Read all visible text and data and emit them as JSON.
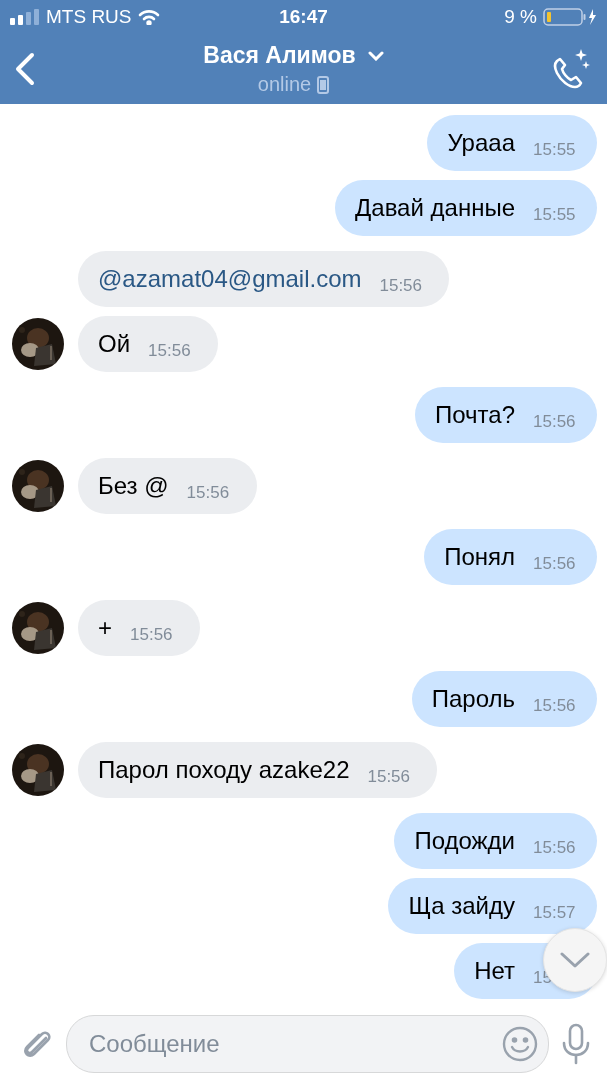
{
  "status_bar": {
    "carrier": "MTS RUS",
    "time": "16:47",
    "battery": "9 %"
  },
  "header": {
    "title": "Вася Алимов",
    "status": "online"
  },
  "messages": [
    {
      "outgoing": true,
      "text": "Урааа",
      "time": "15:55"
    },
    {
      "outgoing": true,
      "text": "Давай данные",
      "time": "15:55"
    },
    {
      "outgoing": false,
      "text": "@azamat04@gmail.com",
      "time": "15:56",
      "link": true
    },
    {
      "outgoing": false,
      "text": "Ой",
      "time": "15:56",
      "link": false
    },
    {
      "outgoing": true,
      "text": "Почта?",
      "time": "15:56"
    },
    {
      "outgoing": false,
      "text": "Без @",
      "time": "15:56",
      "link": false
    },
    {
      "outgoing": true,
      "text": "Понял",
      "time": "15:56"
    },
    {
      "outgoing": false,
      "text": "+",
      "time": "15:56",
      "link": false
    },
    {
      "outgoing": true,
      "text": "Пароль",
      "time": "15:56"
    },
    {
      "outgoing": false,
      "text": "Парол походу azake22",
      "time": "15:56",
      "link": false
    },
    {
      "outgoing": true,
      "text": "Подожди",
      "time": "15:56"
    },
    {
      "outgoing": true,
      "text": "Ща зайду",
      "time": "15:57"
    },
    {
      "outgoing": true,
      "text": "Нет",
      "time": "15"
    }
  ],
  "composer": {
    "placeholder": "Сообщение"
  }
}
